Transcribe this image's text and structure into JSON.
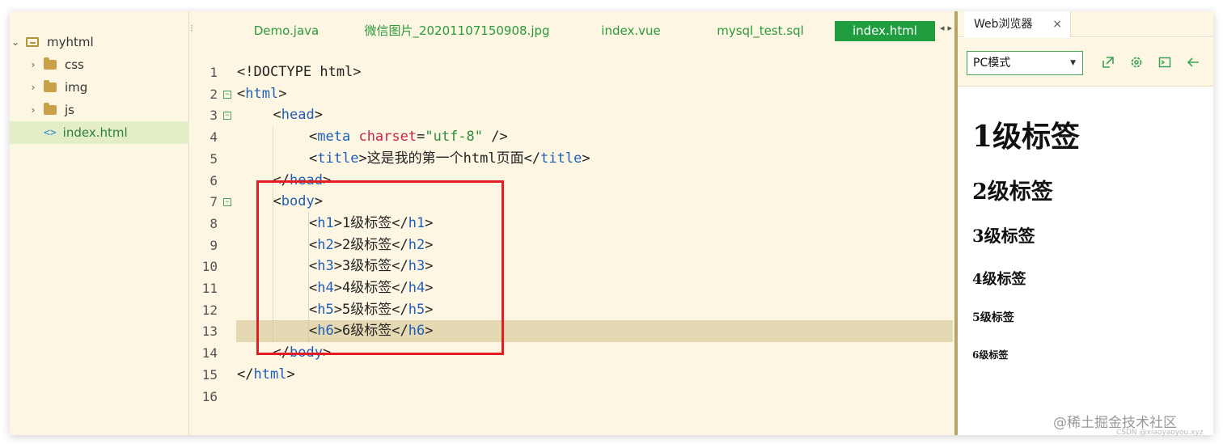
{
  "sidebar": {
    "root": {
      "label": "myhtml"
    },
    "items": [
      {
        "label": "css",
        "type": "folder"
      },
      {
        "label": "img",
        "type": "folder"
      },
      {
        "label": "js",
        "type": "folder"
      },
      {
        "label": "index.html",
        "type": "file"
      }
    ]
  },
  "tabs": [
    {
      "label": "Demo.java"
    },
    {
      "label": "微信图片_20201107150908.jpg"
    },
    {
      "label": "index.vue"
    },
    {
      "label": "mysql_test.sql"
    },
    {
      "label": "index.html",
      "active": true
    }
  ],
  "editor": {
    "current_line": 13,
    "lines": [
      {
        "n": "1",
        "text": "<!DOCTYPE html>"
      },
      {
        "n": "2",
        "text": "<html>"
      },
      {
        "n": "3",
        "text": "<head>"
      },
      {
        "n": "4",
        "text": "<meta charset=\"utf-8\" />"
      },
      {
        "n": "5",
        "text": "<title>这是我的第一个html页面</title>"
      },
      {
        "n": "6",
        "text": "</head>"
      },
      {
        "n": "7",
        "text": "<body>"
      },
      {
        "n": "8",
        "text": "<h1>1级标签</h1>"
      },
      {
        "n": "9",
        "text": "<h2>2级标签</h2>"
      },
      {
        "n": "10",
        "text": "<h3>3级标签</h3>"
      },
      {
        "n": "11",
        "text": "<h4>4级标签</h4>"
      },
      {
        "n": "12",
        "text": "<h5>5级标签</h5>"
      },
      {
        "n": "13",
        "text": "<h6>6级标签</h6>"
      },
      {
        "n": "14",
        "text": "</body>"
      },
      {
        "n": "15",
        "text": "</html>"
      },
      {
        "n": "16",
        "text": ""
      }
    ]
  },
  "browser": {
    "tab_label": "Web浏览器",
    "close_glyph": "×",
    "mode": "PC模式",
    "toolbar_icons": [
      "open-external-icon",
      "settings-icon",
      "console-icon",
      "back-arrow-icon"
    ],
    "headings": [
      "1级标签",
      "2级标签",
      "3级标签",
      "4级标签",
      "5级标签",
      "6级标签"
    ]
  },
  "watermark": "@稀土掘金技术社区",
  "watermark_sub": "CSDN @xiaoyaoyou.xyz",
  "colors": {
    "accent": "#1f9d3f",
    "highlight_box": "#e31d24",
    "editor_bg": "#fdf6e3"
  }
}
